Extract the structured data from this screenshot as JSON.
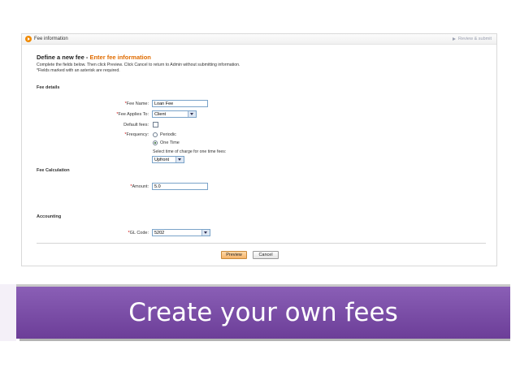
{
  "topbar": {
    "title": "Fee information",
    "step": "Review & submit"
  },
  "heading": {
    "main": "Define a new fee - ",
    "sub": "Enter fee information"
  },
  "intro": {
    "line1": "Complete the fields below. Then click Preview. Click Cancel to return to Admin without submitting information.",
    "line2": "*Fields marked with an asterisk are required."
  },
  "sections": {
    "fee_details": "Fee details",
    "fee_calculation": "Fee Calculation",
    "accounting": "Accounting"
  },
  "fields": {
    "fee_name": {
      "required": "*",
      "label": "Fee Name:",
      "value": "Loan Fee"
    },
    "applies_to": {
      "required": "*",
      "label": "Fee Applies To:",
      "value": "Client"
    },
    "default_fees": {
      "label": "Default fees:",
      "checked": false
    },
    "frequency": {
      "required": "*",
      "label": "Frequency:",
      "options": [
        "Periodic",
        "One Time"
      ],
      "selected": "One Time",
      "hint": "Select time of charge for one time fees:",
      "time_value": "Upfront"
    },
    "amount": {
      "required": "*",
      "label": "Amount:",
      "value": "5.0"
    },
    "gl_code": {
      "required": "*",
      "label": "GL Code:",
      "value": "5202"
    }
  },
  "buttons": {
    "preview": "Preview",
    "cancel": "Cancel"
  },
  "banner": {
    "text": "Create your own fees"
  },
  "colors": {
    "accent": "#e06c00",
    "banner": "#7a4ca8"
  }
}
